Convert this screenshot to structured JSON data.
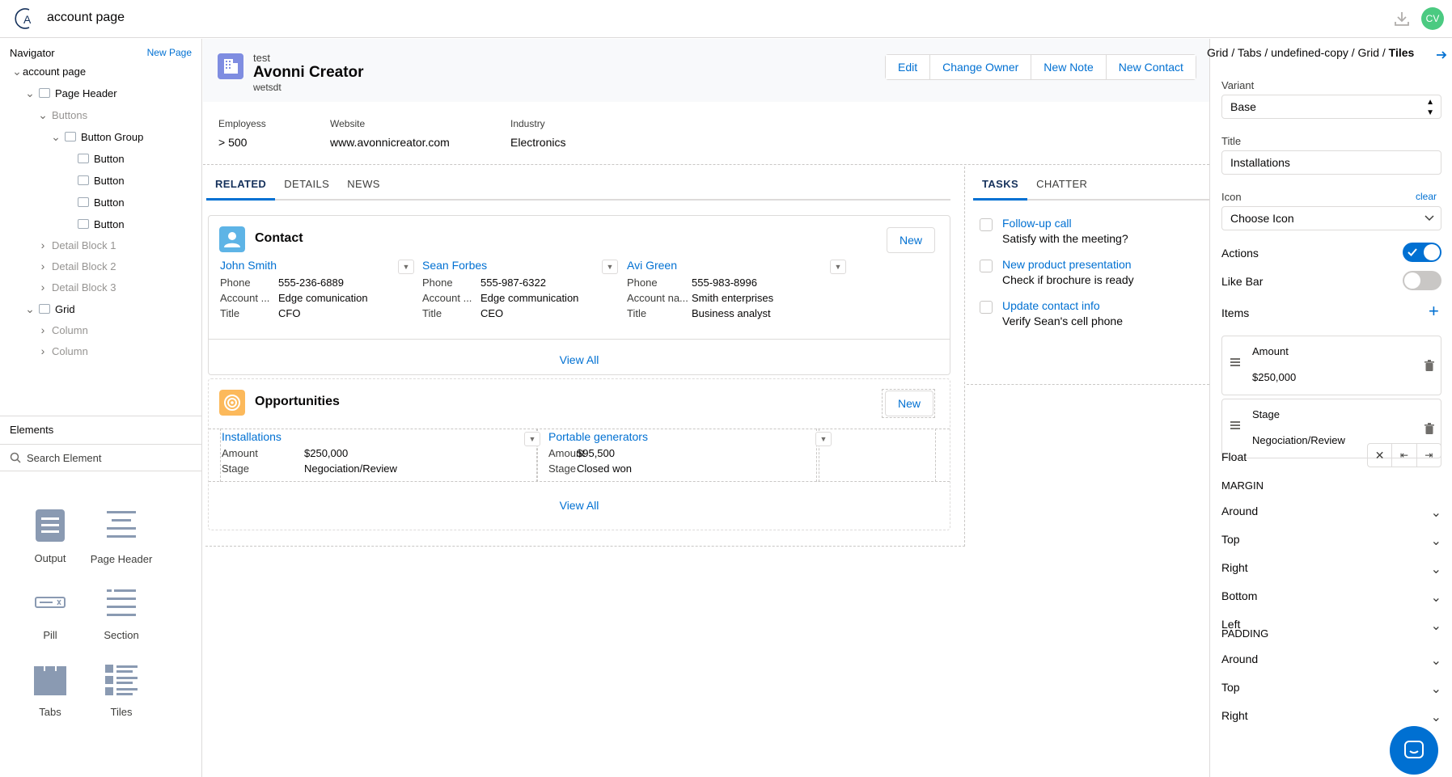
{
  "app": {
    "title": "account page",
    "avatar_initials": "CV",
    "accent": "#0070d2"
  },
  "navigator": {
    "title": "Navigator",
    "new_page": "New Page",
    "tree": [
      {
        "label": "account page",
        "level": 0,
        "expanded": true,
        "dim": false
      },
      {
        "label": "Page Header",
        "level": 1,
        "expanded": true,
        "dim": false
      },
      {
        "label": "Buttons",
        "level": 2,
        "expanded": true,
        "dim": true
      },
      {
        "label": "Button Group",
        "level": 3,
        "expanded": true,
        "dim": false
      },
      {
        "label": "Button",
        "level": 4,
        "dim": false
      },
      {
        "label": "Button",
        "level": 4,
        "dim": false
      },
      {
        "label": "Button",
        "level": 4,
        "dim": false
      },
      {
        "label": "Button",
        "level": 4,
        "dim": false
      },
      {
        "label": "Detail Block 1",
        "level": 2,
        "expanded": false,
        "dim": true
      },
      {
        "label": "Detail Block 2",
        "level": 2,
        "expanded": false,
        "dim": true
      },
      {
        "label": "Detail Block 3",
        "level": 2,
        "expanded": false,
        "dim": true
      },
      {
        "label": "Grid",
        "level": 1,
        "expanded": true,
        "dim": false
      },
      {
        "label": "Column",
        "level": 2,
        "expanded": false,
        "dim": true
      },
      {
        "label": "Column",
        "level": 2,
        "expanded": false,
        "dim": true
      }
    ]
  },
  "elements": {
    "title": "Elements",
    "search_placeholder": "Search Element",
    "tiles": [
      "Output",
      "Page Header",
      "Pill",
      "Section",
      "Tabs",
      "Tiles"
    ]
  },
  "page_header": {
    "overline": "test",
    "title": "Avonni Creator",
    "subtitle": "wetsdt",
    "buttons": [
      "Edit",
      "Change Owner",
      "New Note",
      "New Contact"
    ],
    "fields": [
      {
        "label": "Employess",
        "value": "> 500"
      },
      {
        "label": "Website",
        "value": "www.avonnicreator.com"
      },
      {
        "label": "Industry",
        "value": "Electronics"
      }
    ]
  },
  "main_tabs": [
    "RELATED",
    "DETAILS",
    "NEWS"
  ],
  "contact_card": {
    "title": "Contact",
    "new_label": "New",
    "view_all": "View All",
    "records": [
      {
        "name": "John Smith",
        "phone_label": "Phone",
        "phone": "555-236-6889",
        "account_label": "Account ...",
        "account": "Edge comunication",
        "title_label": "Title",
        "title": "CFO"
      },
      {
        "name": "Sean Forbes",
        "phone_label": "Phone",
        "phone": "555-987-6322",
        "account_label": "Account ...",
        "account": "Edge communication",
        "title_label": "Title",
        "title": "CEO"
      },
      {
        "name": "Avi Green",
        "phone_label": "Phone",
        "phone": "555-983-8996",
        "account_label": "Account na...",
        "account": "Smith enterprises",
        "title_label": "Title",
        "title": "Business analyst"
      }
    ]
  },
  "opportunities_card": {
    "title": "Opportunities",
    "new_label": "New",
    "view_all": "View All",
    "records": [
      {
        "name": "Installations",
        "amount_label": "Amount",
        "amount": "$250,000",
        "stage_label": "Stage",
        "stage": "Negociation/Review"
      },
      {
        "name": "Portable generators",
        "amount_label": "Amount",
        "amount": "$95,500",
        "stage_label": "Stage",
        "stage": "Closed won"
      }
    ]
  },
  "side_tabs": [
    "TASKS",
    "CHATTER"
  ],
  "tasks": [
    {
      "title": "Follow-up call",
      "desc": "Satisfy with the meeting?"
    },
    {
      "title": "New product presentation",
      "desc": "Check if brochure is ready"
    },
    {
      "title": "Update contact info",
      "desc": "Verify Sean's cell phone"
    }
  ],
  "properties": {
    "breadcrumb": [
      "Grid",
      "Tabs",
      "undefined-copy",
      "Grid"
    ],
    "breadcrumb_current": "Tiles",
    "variant_label": "Variant",
    "variant_value": "Base",
    "title_label": "Title",
    "title_value": "Installations",
    "icon_label": "Icon",
    "icon_clear": "clear",
    "icon_value": "Choose Icon",
    "actions_label": "Actions",
    "actions_on": true,
    "likebar_label": "Like Bar",
    "likebar_on": false,
    "items_label": "Items",
    "items": [
      {
        "title": "Amount",
        "value": "$250,000"
      },
      {
        "title": "Stage",
        "value": "Negociation/Review"
      }
    ],
    "float_label": "Float",
    "margin_label": "MARGIN",
    "margin_rows": [
      "Around",
      "Top",
      "Right",
      "Bottom",
      "Left"
    ],
    "padding_label": "PADDING",
    "padding_rows": [
      "Around",
      "Top",
      "Right"
    ]
  }
}
